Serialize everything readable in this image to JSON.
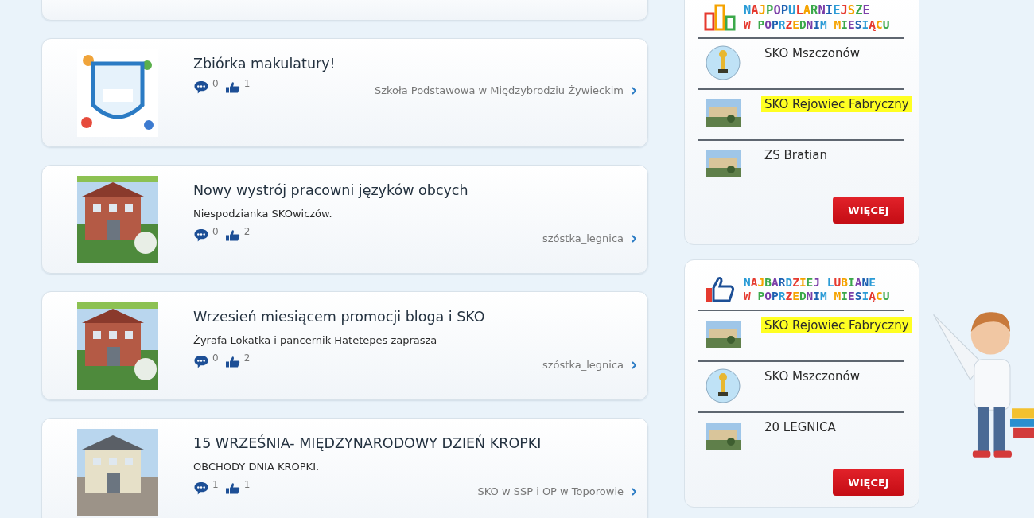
{
  "posts": [
    {
      "title": "Zbiórka makulatury!",
      "comments": "0",
      "likes": "1",
      "author": "Szkoła Podstawowa w Międzybrodziu Żywieckim"
    },
    {
      "title": "Nowy wystrój pracowni języków obcych",
      "excerpt": "Niespodzianka SKOwiczów.",
      "comments": "0",
      "likes": "2",
      "author": "szóstka_legnica"
    },
    {
      "title": "Wrzesień miesiącem promocji bloga i SKO",
      "excerpt": "Żyrafa Lokatka i pancernik Hatetepes zaprasza",
      "comments": "0",
      "likes": "2",
      "author": "szóstka_legnica"
    },
    {
      "title": "15 WRZEŚNIA- MIĘDZYNARODOWY DZIEŃ KROPKI",
      "excerpt": "OBCHODY DNIA KROPKI.",
      "comments": "1",
      "likes": "1",
      "author": "SKO w SSP i OP w Toporowie"
    }
  ],
  "panels": [
    {
      "kind": "popular",
      "heading": [
        "NAJPOPULARNIEJSZE",
        "W POPRZEDNIM MIESIĄCU"
      ],
      "button": "WIĘCEJ",
      "items": [
        {
          "name": "SKO Mszczonów",
          "highlighted": false,
          "kind": "round"
        },
        {
          "name": "SKO Rejowiec Fabryczny",
          "highlighted": true,
          "kind": "square"
        },
        {
          "name": "ZS Bratian",
          "highlighted": false,
          "kind": "square"
        }
      ]
    },
    {
      "kind": "liked",
      "heading": [
        "NAJBARDZIEJ LUBIANE",
        "W POPRZEDNIM MIESIĄCU"
      ],
      "button": "WIĘCEJ",
      "items": [
        {
          "name": "SKO Rejowiec Fabryczny",
          "highlighted": true,
          "kind": "square"
        },
        {
          "name": "SKO Mszczonów",
          "highlighted": false,
          "kind": "round"
        },
        {
          "name": "20 LEGNICA",
          "highlighted": false,
          "kind": "square"
        }
      ]
    }
  ]
}
